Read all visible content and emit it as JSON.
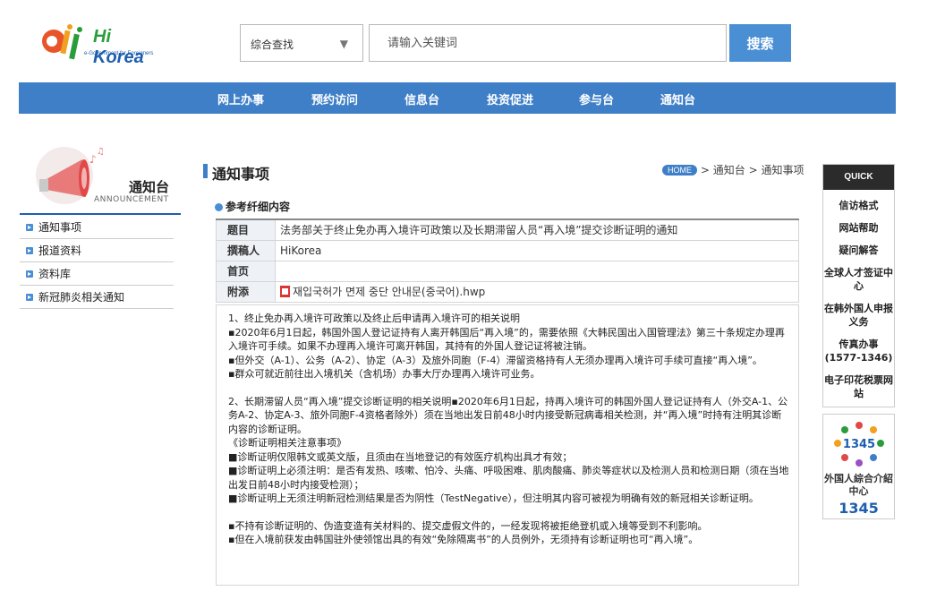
{
  "header": {
    "logo_text_hi": "Hi",
    "logo_text_korea": "Korea",
    "logo_sub": "e-Government for Foreigners",
    "search_type": "综合查找",
    "search_placeholder": "请输入关键词",
    "search_button": "搜索"
  },
  "nav": [
    "网上办事",
    "预约访问",
    "信息台",
    "投资促进",
    "参与台",
    "通知台"
  ],
  "sidebar": {
    "title": "通知台",
    "subtitle": "ANNOUNCEMENT",
    "items": [
      "通知事项",
      "报道资料",
      "资料库",
      "新冠肺炎相关通知"
    ]
  },
  "main": {
    "page_title": "通知事项",
    "breadcrumb": {
      "home": "HOME",
      "sep": ">",
      "level1": "通知台",
      "level2": "通知事项"
    },
    "section_title": "参考纤细内容",
    "table": {
      "subject_label": "题目",
      "subject_value": "法务部关于终止免办再入境许可政策以及长期滞留人员“再入境”提交诊断证明的通知",
      "author_label": "撰稿人",
      "author_value": "HiKorea",
      "home_label": "首页",
      "home_value": "",
      "attach_label": "附添",
      "attach_value": "재입국허가 면제 중단 안내문(중국어).hwp"
    },
    "content": [
      " 1、终止免办再入境许可政策以及终止后申请再入境许可的相关说明",
      "▪2020年6月1日起，韩国外国人登记证持有人离开韩国后“再入境”的，需要依照《大韩民国出入国管理法》第三十条规定办理再入境许可手续。如果不办理再入境许可离开韩国，其持有的外国人登记证将被注销。",
      "▪但外交（A-1）、公务（A-2）、协定（A-3）及旅外同胞（F-4）滞留资格持有人无须办理再入境许可手续可直接“再入境”。",
      "▪群众可就近前往出入境机关（含机场）办事大厅办理再入境许可业务。",
      "",
      "2、长期滞留人员“再入境”提交诊断证明的相关说明▪2020年6月1日起，持再入境许可的韩国外国人登记证持有人（外交A-1、公务A-2、协定A-3、旅外同胞F-4资格者除外）须在当地出发日前48小时内接受新冠病毒相关检测，并“再入境”时持有注明其诊断内容的诊断证明。",
      "《诊断证明相关注意事项》",
      "■诊断证明仅限韩文或英文版，且须由在当地登记的有效医疗机构出具才有效；",
      "■诊断证明上必须注明：是否有发热、咳嗽、怕冷、头痛、呼吸困难、肌肉酸痛、肺炎等症状以及检测人员和检测日期（须在当地出发日前48小时内接受检测）；",
      "■诊断证明上无须注明新冠检测结果是否为阴性（TestNegative），但注明其内容可被视为明确有效的新冠相关诊断证明。",
      "",
      "▪不持有诊断证明的、伪造变造有关材料的、提交虚假文件的，一经发现将被拒绝登机或入境等受到不利影响。",
      "▪但在入境前获发由韩国驻外使领馆出具的有效“免除隔离书”的人员例外，无须持有诊断证明也可“再入境”。"
    ]
  },
  "quick": {
    "header": "QUICK",
    "items": [
      "信访格式",
      "网站帮助",
      "疑问解答",
      "全球人才签证中心",
      "在韩外国人申报义务",
      "传真办事",
      "(1577-1346)",
      "电子印花税票网站"
    ],
    "banner_number_logo": "1345",
    "banner_title": "外国人綜合介紹中心",
    "banner_number": "1345"
  },
  "colors": {
    "brand_blue": "#3f7fc8",
    "dark_blue": "#1d5fae",
    "quick_header": "#2b2b2b"
  }
}
